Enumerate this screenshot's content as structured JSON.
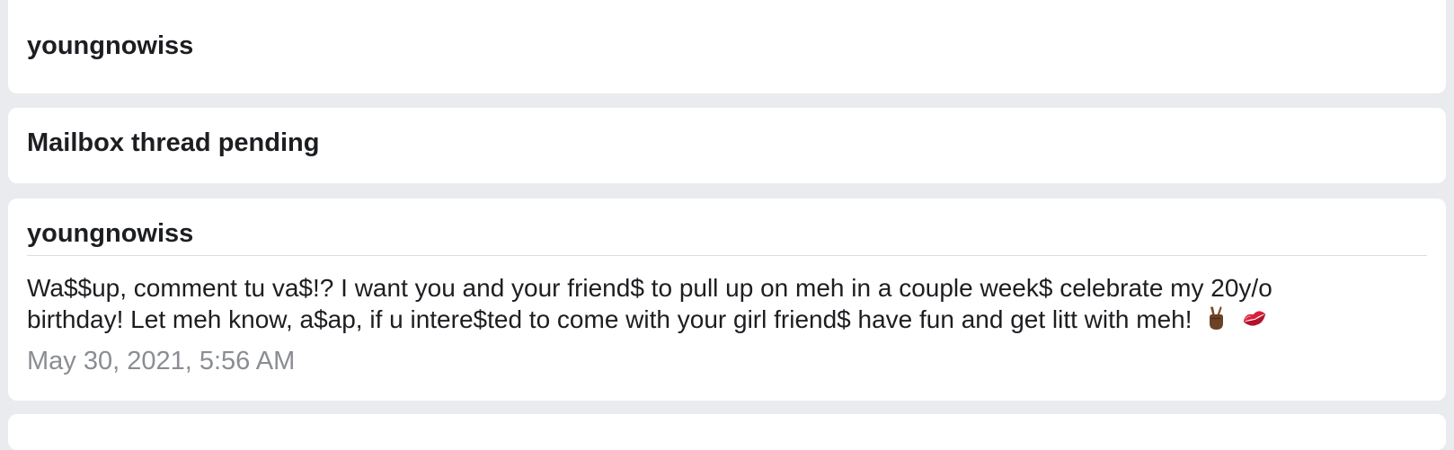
{
  "thread": {
    "header_name": "youngnowiss",
    "status_text": "Mailbox thread pending",
    "message": {
      "sender": "youngnowiss",
      "body_line_1": "Wa$$up, comment tu va$!? I want you and your friend$ to pull up on meh in a couple week$ celebrate my 20y/o",
      "body_line_2": "birthday! Let meh know, a$ap, if u intere$ted to come with your girl friend$ have fun and get litt with meh!",
      "emojis": [
        "victory-hand-icon",
        "kiss-mark-icon"
      ],
      "timestamp": "May 30, 2021, 5:56 AM"
    }
  }
}
